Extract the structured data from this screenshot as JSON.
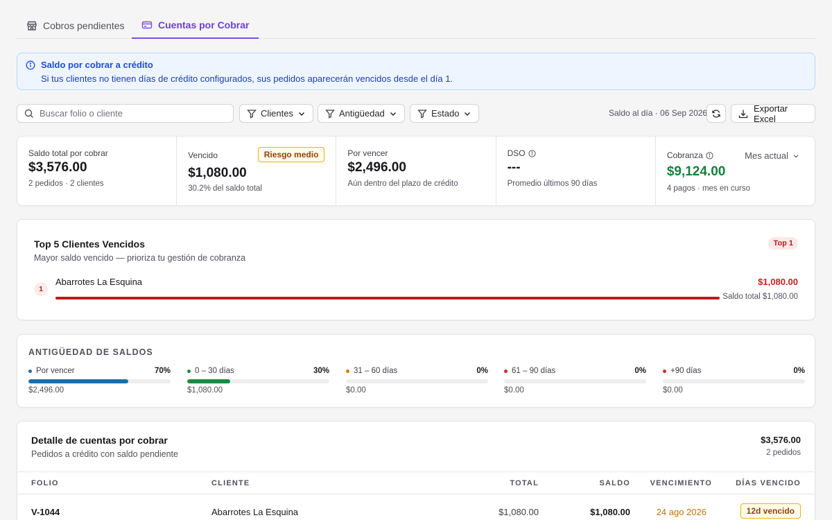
{
  "tabs": [
    {
      "label": "Cobros pendientes",
      "icon": "store-icon",
      "active": false
    },
    {
      "label": "Cuentas por Cobrar",
      "icon": "card-icon",
      "active": true
    }
  ],
  "banner": {
    "title": "Saldo por cobrar a crédito",
    "text": "Si tus clientes no tienen días de crédito configurados, sus pedidos aparecerán vencidos desde el día 1."
  },
  "toolbar": {
    "search_placeholder": "Buscar folio o cliente",
    "filters": [
      "Clientes",
      "Antigüedad",
      "Estado"
    ],
    "as_of": "Saldo al día · 06 Sep 2026",
    "export_label": "Exportar Excel"
  },
  "kpis": {
    "total": {
      "label": "Saldo total por cobrar",
      "value": "$3,576.00",
      "sub": "2 pedidos · 2 clientes"
    },
    "overdue": {
      "label": "Vencido",
      "value": "$1,080.00",
      "sub": "30.2% del saldo total",
      "badge": "Riesgo medio"
    },
    "upcoming": {
      "label": "Por vencer",
      "value": "$2,496.00",
      "sub": "Aún dentro del plazo de crédito"
    },
    "dso": {
      "label": "DSO",
      "value": "---",
      "sub": "Promedio últimos 90 días"
    },
    "collection": {
      "label": "Cobranza",
      "value": "$9,124.00",
      "sub": "4 pagos · mes en curso",
      "period": "Mes actual"
    }
  },
  "top5": {
    "title": "Top 5 Clientes Vencidos",
    "subtitle": "Mayor saldo vencido — prioriza tu gestión de cobranza",
    "pill": "Top 1",
    "clients": [
      {
        "rank": "1",
        "name": "Abarrotes La Esquina",
        "amount": "$1,080.00",
        "total": "Saldo total $1,080.00",
        "share": 1.0
      }
    ]
  },
  "aging": {
    "title": "ANTIGÜEDAD DE SALDOS",
    "buckets": [
      {
        "label": "Por vencer",
        "pct": "70%",
        "fraction": 0.7,
        "amount": "$2,496.00",
        "color": "#1a6fa8"
      },
      {
        "label": "0 – 30 días",
        "pct": "30%",
        "fraction": 0.3,
        "amount": "$1,080.00",
        "color": "#1d8a43"
      },
      {
        "label": "31 – 60 días",
        "pct": "0%",
        "fraction": 0,
        "amount": "$0.00",
        "color": "#d97706"
      },
      {
        "label": "61 – 90 días",
        "pct": "0%",
        "fraction": 0,
        "amount": "$0.00",
        "color": "#dc2626"
      },
      {
        "label": "+90 días",
        "pct": "0%",
        "fraction": 0,
        "amount": "$0.00",
        "color": "#dc2626"
      }
    ]
  },
  "detail": {
    "title": "Detalle de cuentas por cobrar",
    "subtitle": "Pedidos a crédito con saldo pendiente",
    "total": "$3,576.00",
    "count": "2 pedidos",
    "columns": [
      "FOLIO",
      "CLIENTE",
      "TOTAL",
      "SALDO",
      "VENCIMIENTO",
      "DÍAS VENCIDO"
    ],
    "rows": [
      {
        "folio": "V-1044",
        "client": "Abarrotes La Esquina",
        "total": "$1,080.00",
        "balance": "$1,080.00",
        "due": "24 ago 2026",
        "days": "12d vencido"
      }
    ]
  }
}
